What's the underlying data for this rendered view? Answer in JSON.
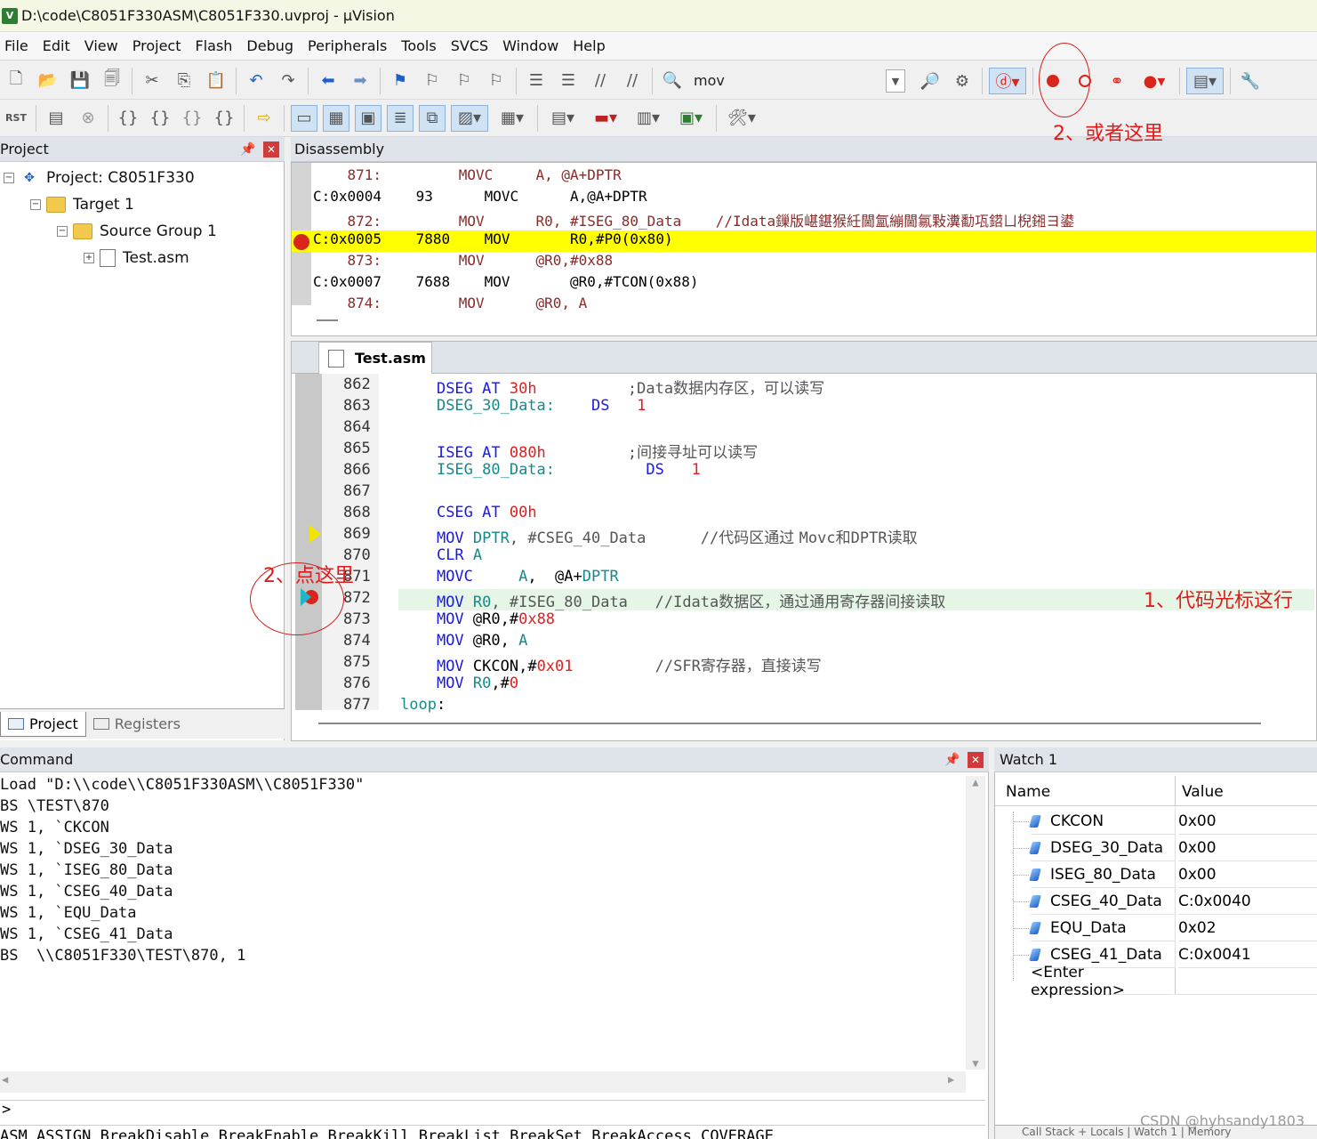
{
  "window": {
    "title": "D:\\code\\C8051F330ASM\\C8051F330.uvproj - µVision",
    "icon_text": "V"
  },
  "menu": [
    "File",
    "Edit",
    "View",
    "Project",
    "Flash",
    "Debug",
    "Peripherals",
    "Tools",
    "SVCS",
    "Window",
    "Help"
  ],
  "toolbar": {
    "find_text": "mov",
    "reset_label": "RST"
  },
  "project_panel": {
    "title": "Project",
    "tree": [
      {
        "label": "Project: C8051F330",
        "expander": "−"
      },
      {
        "label": "Target 1",
        "expander": "−"
      },
      {
        "label": "Source Group 1",
        "expander": "−"
      },
      {
        "label": "Test.asm",
        "expander": "+"
      }
    ],
    "tabs": [
      "Project",
      "Registers"
    ]
  },
  "disassembly": {
    "title": "Disassembly",
    "lines": [
      {
        "text": "    871:         MOVC     A, @A+DPTR",
        "kind": "src"
      },
      {
        "text": "C:0x0004    93      MOVC      A,@A+DPTR",
        "kind": "asm"
      },
      {
        "text": "    872:         MOV      R0, #ISEG_80_Data    //Idata鏁版嵁鍖猴紝閫氳繃閫氱敤瀵勫瓨鍣ㄩ棿鎺ヨ鍙",
        "kind": "src"
      },
      {
        "text": "C:0x0005    7880    MOV       R0,#P0(0x80)",
        "kind": "asm-current"
      },
      {
        "text": "    873:         MOV      @R0,#0x88",
        "kind": "src"
      },
      {
        "text": "C:0x0007    7688    MOV       @R0,#TCON(0x88)",
        "kind": "asm"
      },
      {
        "text": "    874:         MOV      @R0, A",
        "kind": "src"
      }
    ]
  },
  "editor": {
    "tab_label": "Test.asm",
    "lines": [
      {
        "ln": "862",
        "parts": [
          [
            "    ",
            ""
          ],
          [
            "DSEG AT ",
            "kw"
          ],
          [
            "30h",
            "num"
          ],
          [
            "          ;Data",
            "cmt"
          ],
          [
            "数据内存区，可以读写",
            "cmt cn"
          ]
        ]
      },
      {
        "ln": "863",
        "parts": [
          [
            "    ",
            ""
          ],
          [
            "DSEG_30_Data:",
            "id"
          ],
          [
            "    ",
            ""
          ],
          [
            "DS",
            "kw"
          ],
          [
            "   ",
            ""
          ],
          [
            "1",
            "num"
          ]
        ]
      },
      {
        "ln": "864",
        "parts": []
      },
      {
        "ln": "865",
        "parts": [
          [
            "    ",
            ""
          ],
          [
            "ISEG AT ",
            "kw"
          ],
          [
            "080h",
            "num"
          ],
          [
            "         ;",
            "cmt"
          ],
          [
            "间接寻址可以读写",
            "cmt cn"
          ]
        ]
      },
      {
        "ln": "866",
        "parts": [
          [
            "    ",
            ""
          ],
          [
            "ISEG_80_Data:",
            "id"
          ],
          [
            "          ",
            ""
          ],
          [
            "DS",
            "kw"
          ],
          [
            "   ",
            ""
          ],
          [
            "1",
            "num"
          ]
        ]
      },
      {
        "ln": "867",
        "parts": []
      },
      {
        "ln": "868",
        "parts": [
          [
            "    ",
            ""
          ],
          [
            "CSEG AT ",
            "kw"
          ],
          [
            "00h",
            "num"
          ]
        ]
      },
      {
        "ln": "869",
        "parts": [
          [
            "    ",
            ""
          ],
          [
            "MOV ",
            "kw"
          ],
          [
            "DPTR",
            "id"
          ],
          [
            ", #CSEG_40_Data      //",
            "cmt"
          ],
          [
            "代码区通过 ",
            "cmt cn"
          ],
          [
            "Movc",
            "cmt"
          ],
          [
            "和",
            "cmt cn"
          ],
          [
            "DPTR",
            "cmt"
          ],
          [
            "读取",
            "cmt cn"
          ]
        ]
      },
      {
        "ln": "870",
        "parts": [
          [
            "    ",
            ""
          ],
          [
            "CLR ",
            "kw"
          ],
          [
            "A",
            "id"
          ]
        ]
      },
      {
        "ln": "871",
        "parts": [
          [
            "    ",
            ""
          ],
          [
            "MOVC",
            "kw"
          ],
          [
            "     ",
            ""
          ],
          [
            "A",
            "id"
          ],
          [
            ",  @A+",
            ""
          ],
          [
            "DPTR",
            "id"
          ]
        ]
      },
      {
        "ln": "872",
        "parts": [
          [
            "    ",
            ""
          ],
          [
            "MOV ",
            "kw"
          ],
          [
            "R0",
            "id"
          ],
          [
            ", #ISEG_80_Data   //Idata",
            "cmt"
          ],
          [
            "数据区，通过通用寄存器间接读取",
            "cmt cn"
          ]
        ]
      },
      {
        "ln": "873",
        "parts": [
          [
            "    ",
            ""
          ],
          [
            "MOV ",
            "kw"
          ],
          [
            "@R0,#",
            ""
          ],
          [
            "0x88",
            "num"
          ]
        ]
      },
      {
        "ln": "874",
        "parts": [
          [
            "    ",
            ""
          ],
          [
            "MOV ",
            "kw"
          ],
          [
            "@R0, ",
            ""
          ],
          [
            "A",
            "id"
          ]
        ]
      },
      {
        "ln": "875",
        "parts": [
          [
            "    ",
            ""
          ],
          [
            "MOV ",
            "kw"
          ],
          [
            "CKCON,#",
            ""
          ],
          [
            "0x01",
            "num"
          ],
          [
            "         //SFR",
            "cmt"
          ],
          [
            "寄存器，直接读写",
            "cmt cn"
          ]
        ]
      },
      {
        "ln": "876",
        "parts": [
          [
            "    ",
            ""
          ],
          [
            "MOV ",
            "kw"
          ],
          [
            "R0",
            "id"
          ],
          [
            ",#",
            ""
          ],
          [
            "0",
            "num"
          ]
        ]
      },
      {
        "ln": "877",
        "parts": [
          [
            "loop",
            "id"
          ],
          [
            ":",
            ""
          ]
        ]
      }
    ]
  },
  "command": {
    "title": "Command",
    "lines": [
      "Load \"D:\\\\code\\\\C8051F330ASM\\\\C8051F330\"",
      "BS \\TEST\\870",
      "WS 1, `CKCON",
      "WS 1, `DSEG_30_Data",
      "WS 1, `ISEG_80_Data",
      "WS 1, `CSEG_40_Data",
      "WS 1, `EQU_Data",
      "WS 1, `CSEG_41_Data",
      "BS  \\\\C8051F330\\TEST\\870, 1"
    ],
    "prompt": ">",
    "help_line": "ASM ASSIGN BreakDisable BreakEnable BreakKill BreakList BreakSet BreakAccess COVERAGE"
  },
  "watch": {
    "title": "Watch 1",
    "col_name": "Name",
    "col_value": "Value",
    "rows": [
      {
        "name": "CKCON",
        "value": "0x00"
      },
      {
        "name": "DSEG_30_Data",
        "value": "0x00"
      },
      {
        "name": "ISEG_80_Data",
        "value": "0x00"
      },
      {
        "name": "CSEG_40_Data",
        "value": "C:0x0040"
      },
      {
        "name": "EQU_Data",
        "value": "0x02"
      },
      {
        "name": "CSEG_41_Data",
        "value": "C:0x0041"
      }
    ],
    "enter_expression": "<Enter expression>",
    "bottom_tabs": "Call Stack + Locals | Watch 1 | Memory"
  },
  "annotations": {
    "toolbar_hint": "2、或者这里",
    "gutter_hint": "2、点这里",
    "line_hint": "1、代码光标这行",
    "color": "#e01b1b"
  },
  "watermark": "CSDN @hyhsandy1803",
  "colors": {
    "current_line": "#ffff00",
    "cursor_line": "#e6f6e6",
    "breakpoint": "#d9261c"
  }
}
